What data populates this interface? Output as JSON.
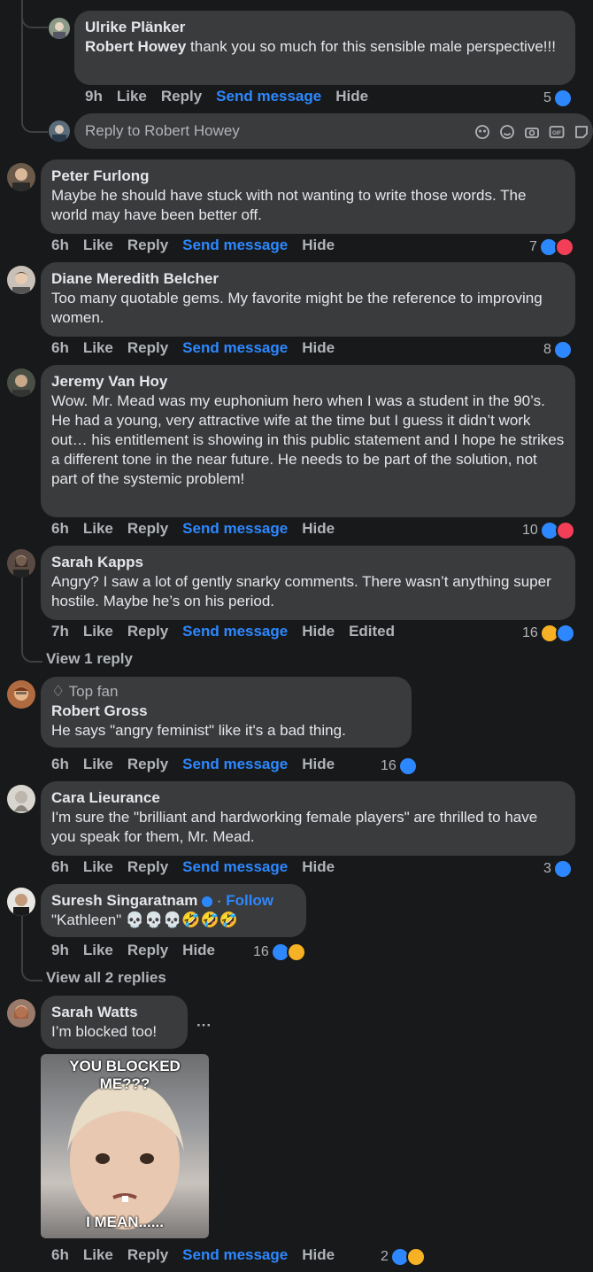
{
  "colors": {
    "background": "#18191a",
    "bubble": "#3a3b3c",
    "link": "#2d88ff",
    "muted": "#b0b3b8"
  },
  "comment_ulrike": {
    "name": "Ulrike Plänker",
    "mention": "Robert Howey",
    "text": " thank you so much for this sensible male perspective!!!",
    "time": "9h",
    "like": "Like",
    "reply": "Reply",
    "send": "Send message",
    "hide": "Hide",
    "reactions": "5"
  },
  "reply_box": {
    "placeholder": "Reply to Robert Howey",
    "icons": [
      "sticker-face-icon",
      "emoji-icon",
      "camera-icon",
      "gif-icon",
      "sticker-icon"
    ]
  },
  "comment_peter": {
    "name": "Peter Furlong",
    "text": "Maybe he should have stuck with not wanting to write those words. The world may have been better off.",
    "time": "6h",
    "like": "Like",
    "reply": "Reply",
    "send": "Send message",
    "hide": "Hide",
    "reactions": "7"
  },
  "comment_diane": {
    "name": "Diane Meredith Belcher",
    "text": "Too many quotable gems. My favorite might be the reference to improving women.",
    "time": "6h",
    "like": "Like",
    "reply": "Reply",
    "send": "Send message",
    "hide": "Hide",
    "reactions": "8"
  },
  "comment_jeremy": {
    "name": "Jeremy Van Hoy",
    "text": "Wow. Mr. Mead was my euphonium hero when I was a student in the 90’s. He had a young, very attractive wife at the time but I guess it didn’t work out… his entitlement is showing in this public statement and I hope he strikes a different tone in the near future. He needs to be part of the solution, not part of the systemic problem!",
    "time": "6h",
    "like": "Like",
    "reply": "Reply",
    "send": "Send message",
    "hide": "Hide",
    "reactions": "10"
  },
  "comment_sarahk": {
    "name": "Sarah Kapps",
    "text": "Angry? I saw a lot of gently snarky comments. There wasn’t anything super hostile. Maybe he’s on his period.",
    "time": "7h",
    "like": "Like",
    "reply": "Reply",
    "send": "Send message",
    "hide": "Hide",
    "edited": "Edited",
    "reactions": "16",
    "view_replies": "View 1 reply"
  },
  "comment_robertg": {
    "badge": "Top fan",
    "name": "Robert Gross",
    "text": "He says \"angry feminist\" like it's a bad thing.",
    "time": "6h",
    "like": "Like",
    "reply": "Reply",
    "send": "Send message",
    "hide": "Hide",
    "reactions": "16"
  },
  "comment_cara": {
    "name": "Cara Lieurance",
    "text": "I'm sure the \"brilliant and hardworking female players\" are thrilled to have you speak for them, Mr. Mead.",
    "time": "6h",
    "like": "Like",
    "reply": "Reply",
    "send": "Send message",
    "hide": "Hide",
    "reactions": "3"
  },
  "comment_suresh": {
    "name": "Suresh Singaratnam",
    "follow": "Follow",
    "text": "\"Kathleen\" 💀💀💀🤣🤣🤣",
    "time": "9h",
    "like": "Like",
    "reply": "Reply",
    "hide": "Hide",
    "reactions": "16",
    "view_replies": "View all 2 replies"
  },
  "comment_sarahw": {
    "name": "Sarah Watts",
    "text": "I’m blocked too!",
    "more": "···",
    "gif_top": "YOU BLOCKED ME???",
    "gif_bottom": "I MEAN......",
    "time": "6h",
    "like": "Like",
    "reply": "Reply",
    "send": "Send message",
    "hide": "Hide",
    "reactions": "2"
  }
}
